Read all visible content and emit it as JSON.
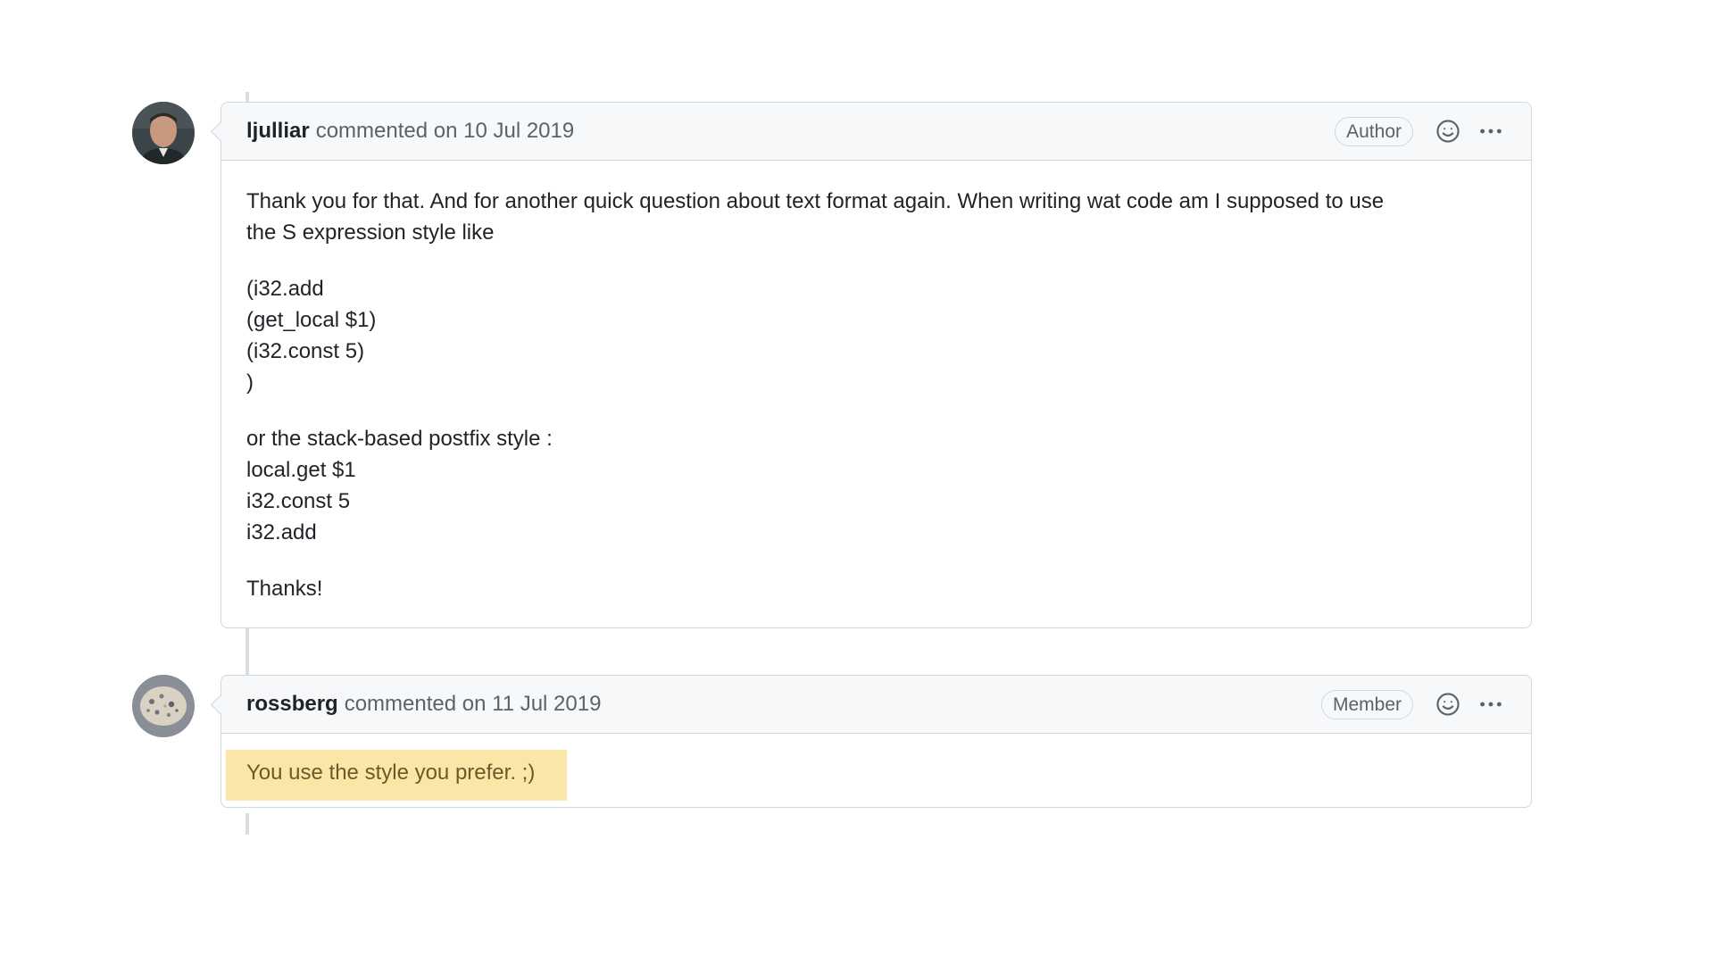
{
  "comments": [
    {
      "author": "ljulliar",
      "meta": "commented on 10 Jul 2019",
      "role": "Author",
      "body_lines": [
        [
          "Thank you for that. And for another quick question about text format again. When writing wat code am I supposed to use",
          "the S expression style like"
        ],
        [
          "(i32.add",
          "(get_local $1)",
          "(i32.const 5)",
          ")"
        ],
        [
          "or the stack-based postfix style :",
          "local.get $1",
          "i32.const 5",
          "i32.add"
        ],
        [
          "Thanks!"
        ]
      ]
    },
    {
      "author": "rossberg",
      "meta": "commented on 11 Jul 2019",
      "role": "Member",
      "highlight_text": "You use the style you prefer. ;)"
    }
  ],
  "icons": {
    "reaction": "smiley-icon",
    "menu": "kebab-horizontal-icon"
  },
  "colors": {
    "highlight_bg": "#fae7a8",
    "header_bg": "#f6f8fa",
    "border": "#d0d7de"
  }
}
